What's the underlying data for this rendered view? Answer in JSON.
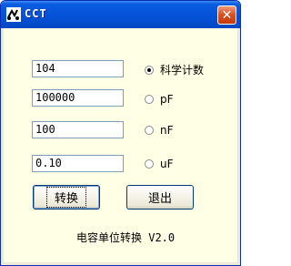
{
  "window": {
    "title": "CCT",
    "close_glyph": "✕"
  },
  "inputs": {
    "scientific_value": "104",
    "pf_value": "100000",
    "nf_value": "100",
    "uf_value": "0.10"
  },
  "options": [
    {
      "label": "科学计数",
      "checked": true
    },
    {
      "label": "pF",
      "checked": false
    },
    {
      "label": "nF",
      "checked": false
    },
    {
      "label": "uF",
      "checked": false
    }
  ],
  "buttons": {
    "convert_label": "转换",
    "exit_label": "退出"
  },
  "footer": {
    "version_text": "电容单位转换 V2.0"
  },
  "colors": {
    "client_background": "#ffffe6",
    "titlebar": "#0552d8",
    "close_button": "#d94e1c"
  },
  "icons": {
    "app": "capacitor-app-icon",
    "close": "close-icon"
  }
}
